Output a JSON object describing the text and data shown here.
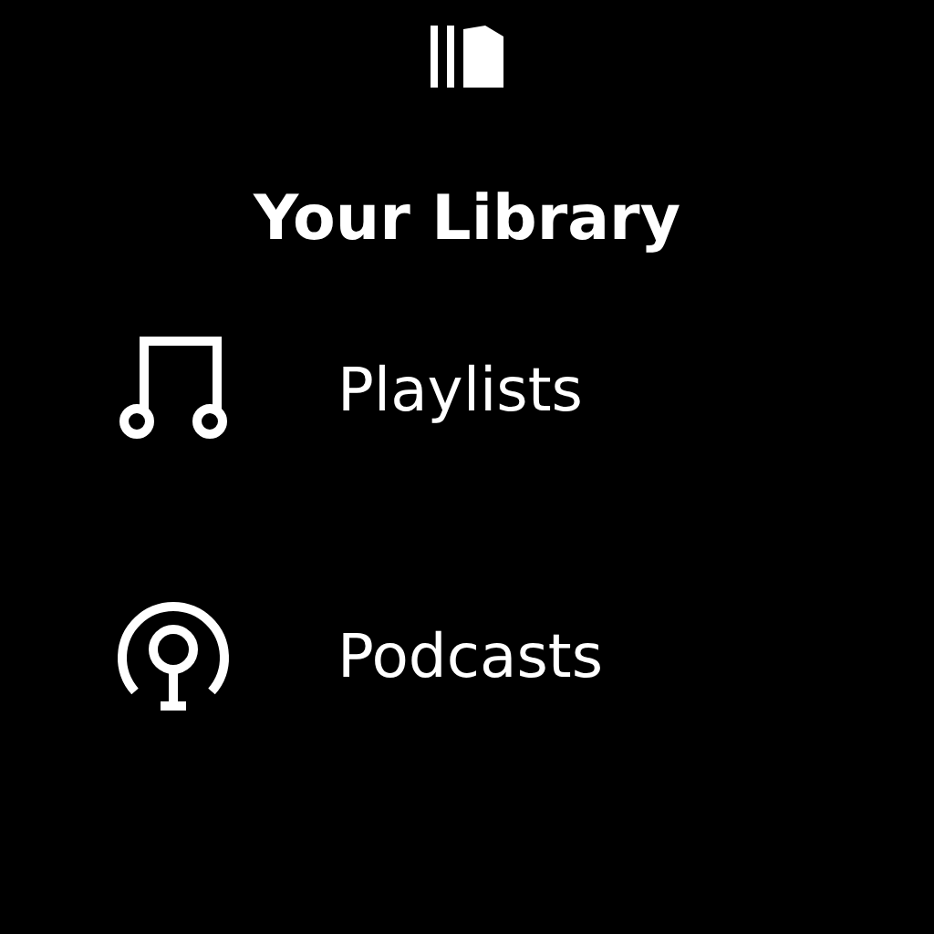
{
  "title": "Your Library",
  "items": [
    {
      "kind": "playlists",
      "label": "Playlists"
    },
    {
      "kind": "podcasts",
      "label": "Podcasts"
    }
  ]
}
